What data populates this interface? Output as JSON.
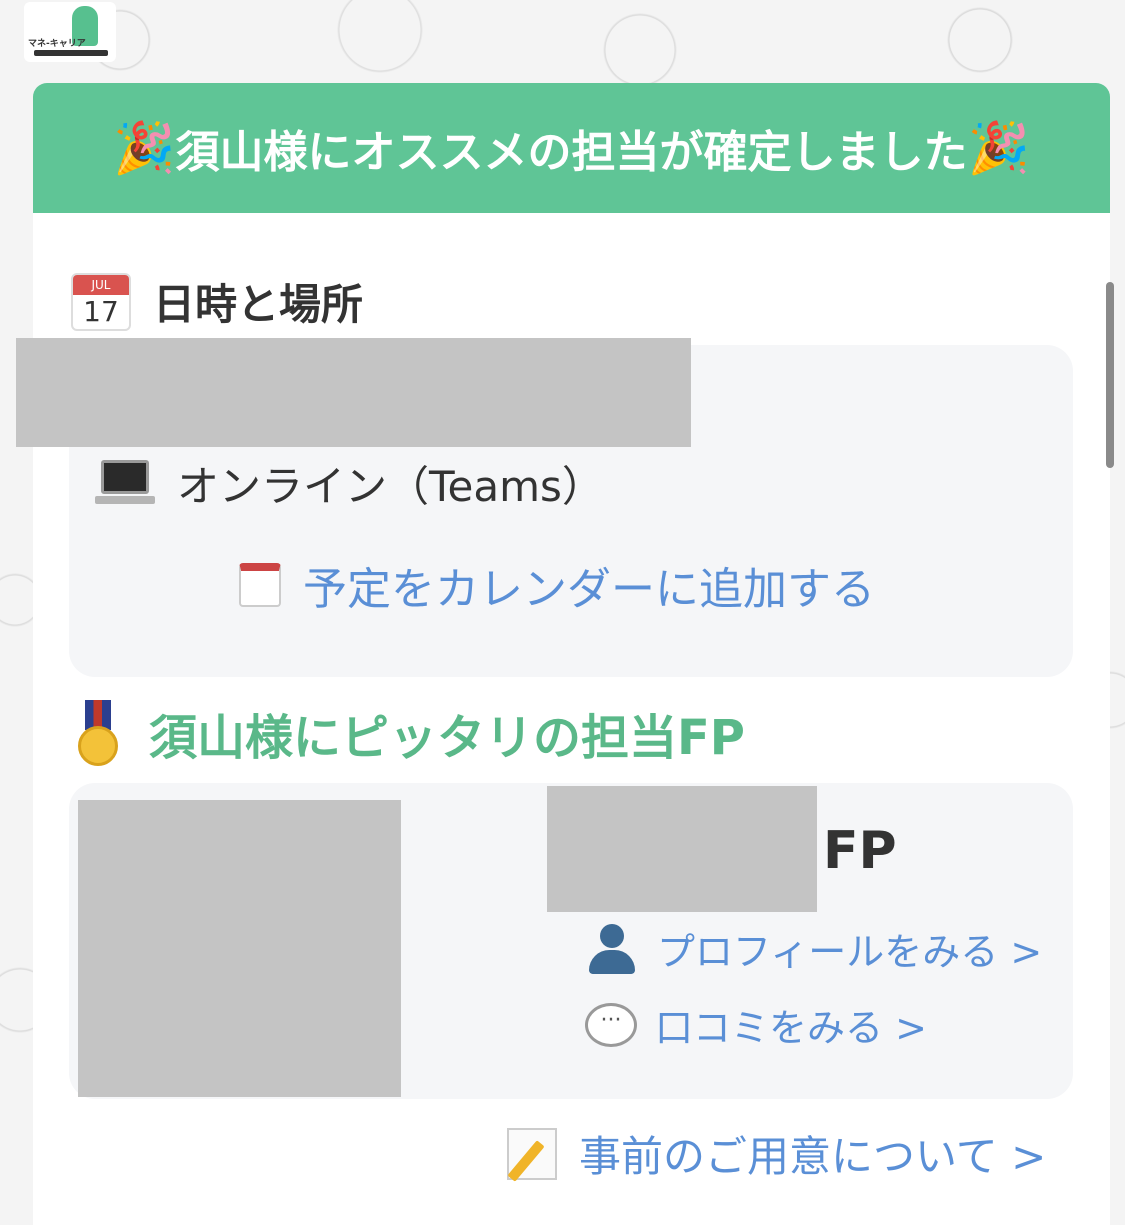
{
  "brand": {
    "logo_text": "マネ-キャリア"
  },
  "banner": {
    "emoji_left": "🎉",
    "title": "須山様にオススメの担当が確定しました",
    "emoji_right": "🎉",
    "color": "#5fc596"
  },
  "date_section": {
    "icon_month": "JUL",
    "icon_day": "17",
    "heading": "日時と場所",
    "location": "オンライン（Teams）",
    "calendar_link": "予定をカレンダーに追加する"
  },
  "fp_section": {
    "heading": "須山様にピッタリの担当FP",
    "heading_color": "#5ab889",
    "fp_suffix": "FP",
    "profile_link": "プロフィールをみる >",
    "review_link": "口コミをみる >",
    "bubble_glyph": "···"
  },
  "prep_link": "事前のご用意について >",
  "link_color": "#5a8fd6"
}
